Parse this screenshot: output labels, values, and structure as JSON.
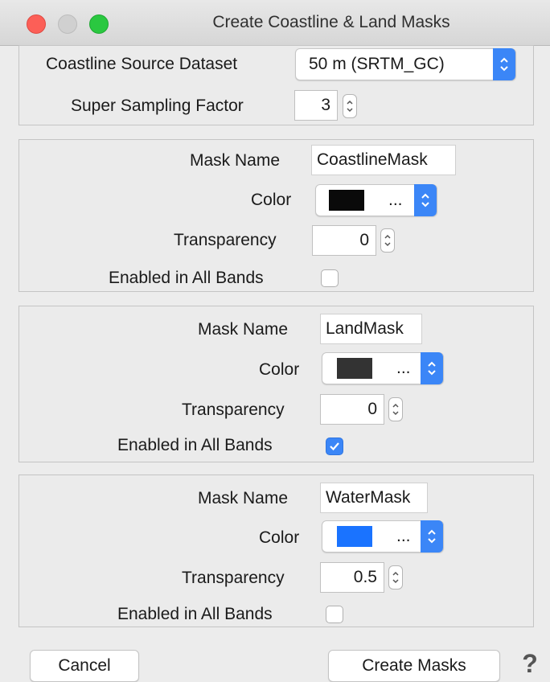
{
  "window": {
    "title": "Create Coastline & Land Masks"
  },
  "source": {
    "label": "Coastline Source Dataset",
    "value": "50 m (SRTM_GC)",
    "supersampling_label": "Super Sampling Factor",
    "supersampling_value": "3"
  },
  "masks": [
    {
      "name_label": "Mask Name",
      "name": "CoastlineMask",
      "color_label": "Color",
      "color": "#0a0a0a",
      "color_dots": "...",
      "transparency_label": "Transparency",
      "transparency": "0",
      "enabled_label": "Enabled in All Bands",
      "enabled": false
    },
    {
      "name_label": "Mask Name",
      "name": "LandMask",
      "color_label": "Color",
      "color": "#333333",
      "color_dots": "...",
      "transparency_label": "Transparency",
      "transparency": "0",
      "enabled_label": "Enabled in All Bands",
      "enabled": true
    },
    {
      "name_label": "Mask Name",
      "name": "WaterMask",
      "color_label": "Color",
      "color": "#1a73ff",
      "color_dots": "...",
      "transparency_label": "Transparency",
      "transparency": "0.5",
      "enabled_label": "Enabled in All Bands",
      "enabled": false
    }
  ],
  "buttons": {
    "cancel": "Cancel",
    "create": "Create Masks"
  },
  "icons": {
    "help": "?"
  }
}
